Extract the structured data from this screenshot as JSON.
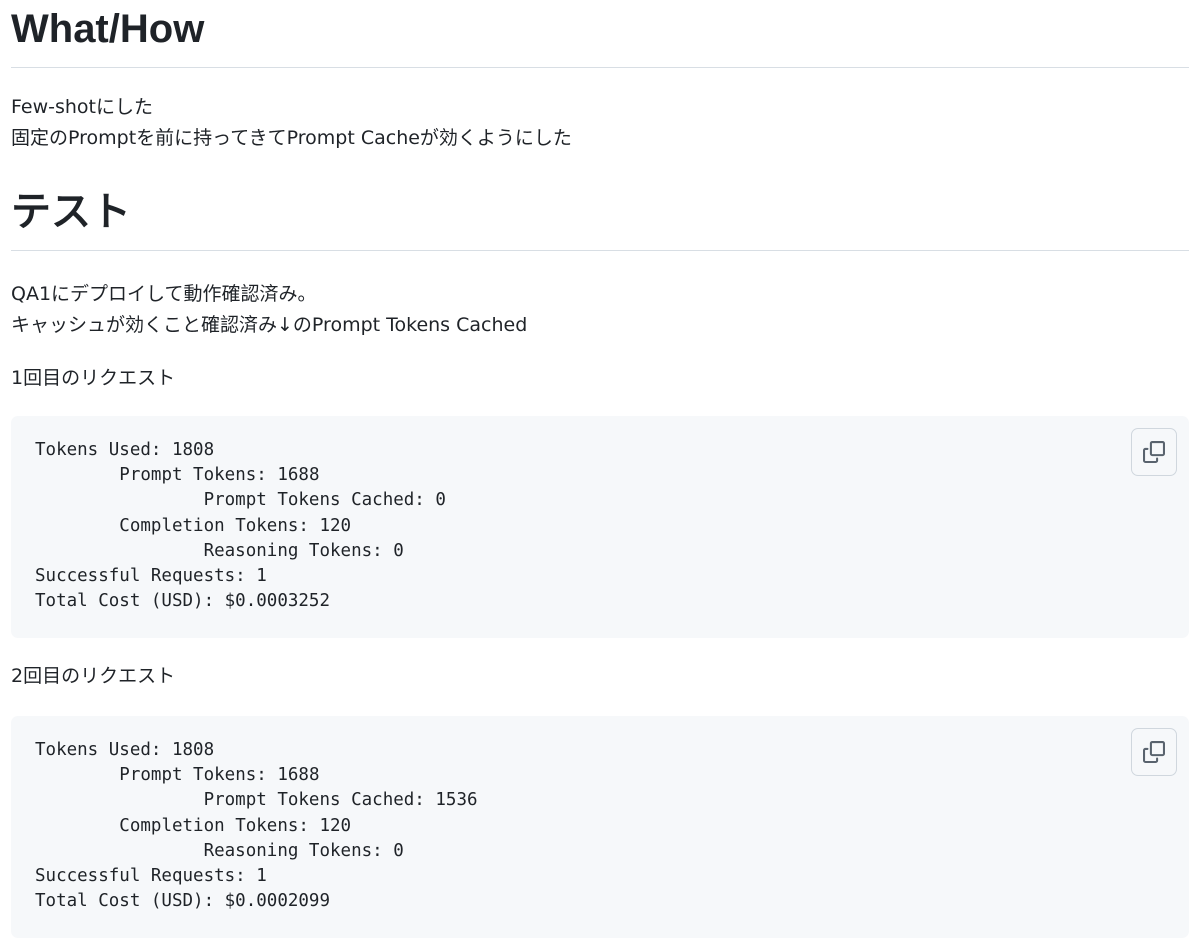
{
  "section1": {
    "heading": "What/How",
    "lines": [
      "Few-shotにした",
      "固定のPromptを前に持ってきてPrompt Cacheが効くようにした"
    ]
  },
  "section2": {
    "heading": "テスト",
    "lines": [
      "QA1にデプロイして動作確認済み。",
      "キャッシュが効くこと確認済み↓のPrompt Tokens Cached"
    ]
  },
  "request1": {
    "label": "1回目のリクエスト",
    "code": "Tokens Used: 1808\n\tPrompt Tokens: 1688\n\t\tPrompt Tokens Cached: 0\n\tCompletion Tokens: 120\n\t\tReasoning Tokens: 0\nSuccessful Requests: 1\nTotal Cost (USD): $0.0003252",
    "copy_icon": "copy-icon"
  },
  "request2": {
    "label": "2回目のリクエスト",
    "code": "Tokens Used: 1808\n\tPrompt Tokens: 1688\n\t\tPrompt Tokens Cached: 1536\n\tCompletion Tokens: 120\n\t\tReasoning Tokens: 0\nSuccessful Requests: 1\nTotal Cost (USD): $0.0002099",
    "copy_icon": "copy-icon"
  },
  "colors": {
    "text": "#1f2328",
    "code_background": "#f6f8fa",
    "border": "#d0d7de",
    "icon": "#59636e"
  }
}
